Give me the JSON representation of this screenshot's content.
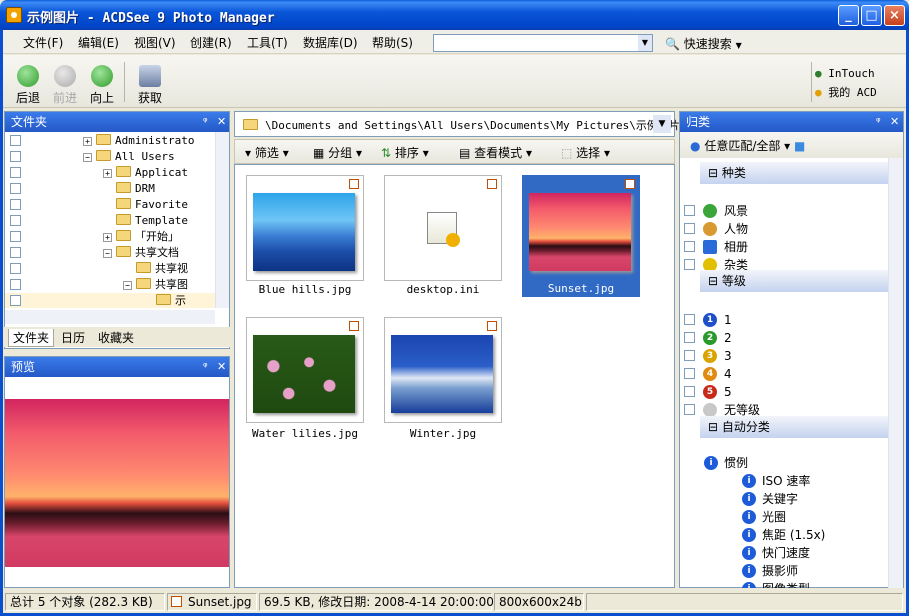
{
  "window": {
    "title": "示例图片 - ACDSee 9 Photo Manager",
    "controls": [
      "_",
      "□",
      "×"
    ]
  },
  "menu": {
    "items": [
      "文件(F)",
      "编辑(E)",
      "视图(V)",
      "创建(R)",
      "工具(T)",
      "数据库(D)",
      "帮助(S)"
    ],
    "search_value": "",
    "quick_search": "快速搜索"
  },
  "toolbar": {
    "back": "后退",
    "forward": "前进",
    "up": "向上",
    "acquire": "获取",
    "intouch": "InTouch",
    "my_acd": "我的 ACD"
  },
  "folders_panel": {
    "title": "文件夹",
    "tree": [
      {
        "label": "Administrato",
        "expander": "+"
      },
      {
        "label": "All Users",
        "expander": "−"
      },
      {
        "label": "Applicat",
        "expander": "+"
      },
      {
        "label": "DRM",
        "expander": ""
      },
      {
        "label": "Favorite",
        "expander": ""
      },
      {
        "label": "Template",
        "expander": ""
      },
      {
        "label": "「开始」",
        "expander": "+"
      },
      {
        "label": "共享文档",
        "expander": "−"
      },
      {
        "label": "共享视",
        "expander": ""
      },
      {
        "label": "共享图",
        "expander": "−"
      },
      {
        "label": "示",
        "expander": ""
      }
    ],
    "tabs": [
      "文件夹",
      "日历",
      "收藏夹"
    ]
  },
  "preview_panel": {
    "title": "预览"
  },
  "path_bar": {
    "path": "\\Documents and Settings\\All Users\\Documents\\My Pictures\\示例图片"
  },
  "file_toolbar": {
    "filter": "筛选",
    "group": "分组",
    "sort": "排序",
    "view_mode": "查看模式",
    "select": "选择"
  },
  "files": [
    {
      "name": "Blue hills.jpg",
      "selected": false
    },
    {
      "name": "desktop.ini",
      "selected": false
    },
    {
      "name": "Sunset.jpg",
      "selected": true
    },
    {
      "name": "Water lilies.jpg",
      "selected": false
    },
    {
      "name": "Winter.jpg",
      "selected": false
    }
  ],
  "categories_panel": {
    "title": "归类",
    "match": "任意匹配/全部",
    "kinds_header": "种类",
    "kinds": [
      "风景",
      "人物",
      "相册",
      "杂类"
    ],
    "ratings_header": "等级",
    "ratings": [
      "1",
      "2",
      "3",
      "4",
      "5",
      "无等级"
    ],
    "auto_header": "自动分类",
    "auto_root": "惯例",
    "auto_items": [
      "ISO 速率",
      "关键字",
      "光圈",
      "焦距 (1.5x)",
      "快门速度",
      "摄影师",
      "图像类型"
    ]
  },
  "statusbar": {
    "total": "总计 5 个对象 (282.3 KB)",
    "file": "Sunset.jpg",
    "info": "69.5 KB, 修改日期: 2008-4-14 20:00:00",
    "dims": "800x600x24b"
  },
  "colors": {
    "titlebar": "#0a56d8",
    "panel_header": "#2459c7",
    "selection": "#316ac5"
  }
}
